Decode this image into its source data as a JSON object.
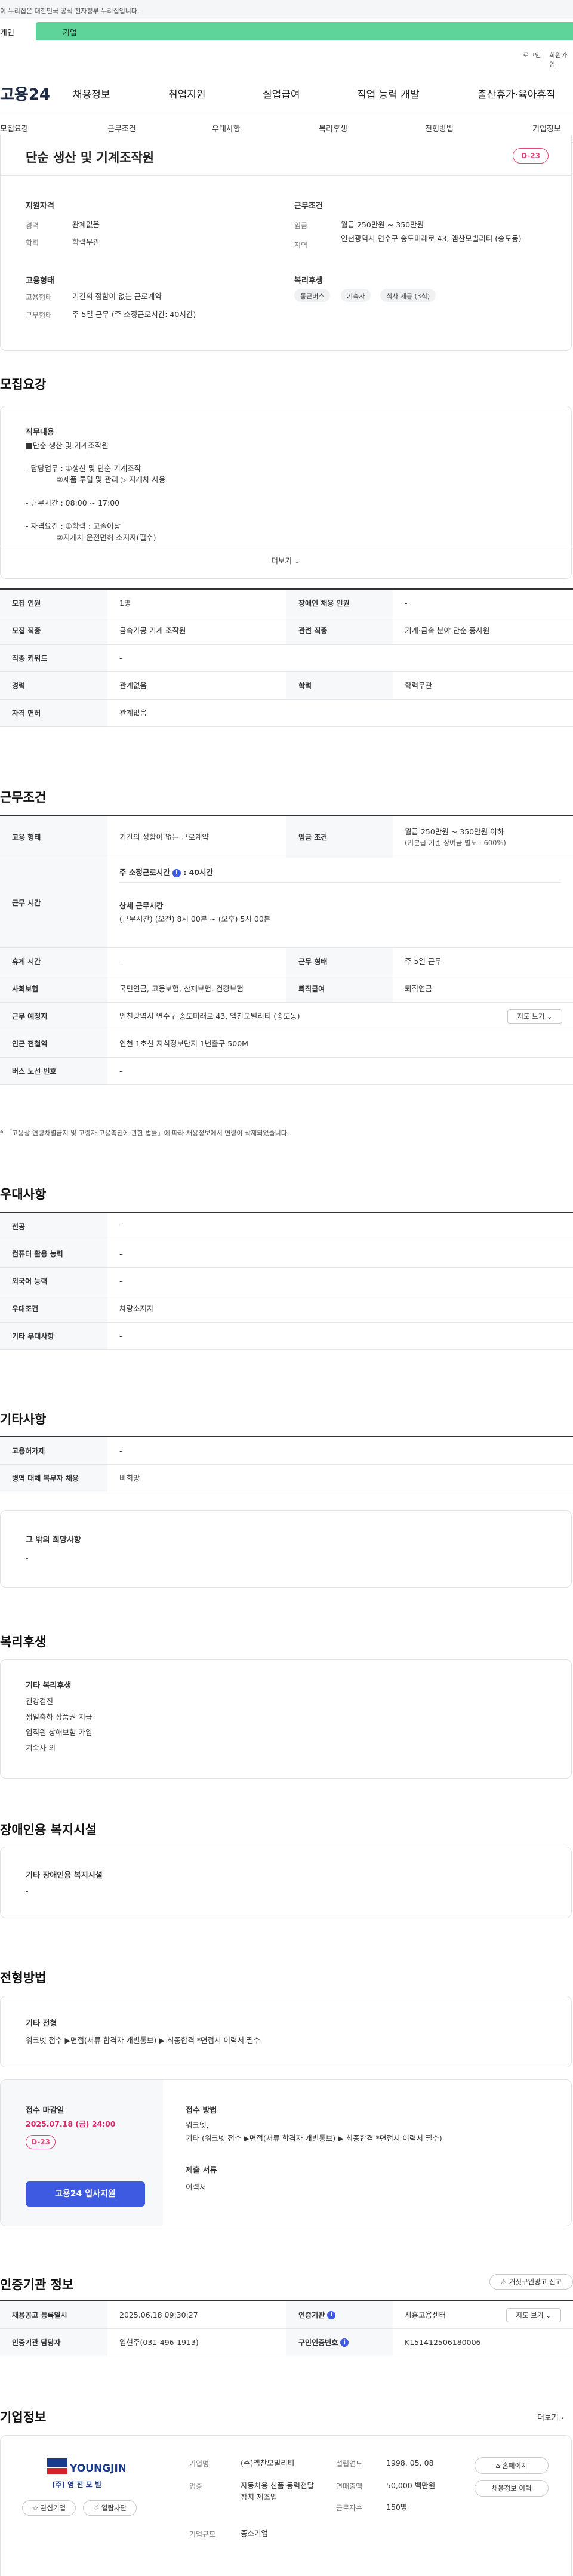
{
  "gov_banner": "이 누리집은 대한민국 공식 전자정부 누리집입니다.",
  "tabs": {
    "tab_personal": "개인",
    "tab_company": "기업"
  },
  "util": {
    "login": "로그인",
    "signup": "회원가입"
  },
  "gnb": {
    "logo": "고용24",
    "items": [
      "채용정보",
      "취업지원",
      "실업급여",
      "직업 능력 개발",
      "출산휴가·육아휴직"
    ]
  },
  "snb": [
    "모집요강",
    "근무조건",
    "우대사항",
    "복리후생",
    "전형방법",
    "기업정보"
  ],
  "summary": {
    "title": "단순 생산 및 기계조작원",
    "dday": "D-23",
    "qual_head": "지원자격",
    "exp_label": "경력",
    "exp_value": "관계없음",
    "edu_label": "학력",
    "edu_value": "학력무관",
    "emp_head": "고용형태",
    "emptype_label": "고용형태",
    "emptype_value": "기간의 정함이 없는 근로계약",
    "worktype_label": "근무형태",
    "worktype_value": "주 5일 근무 (주 소정근로시간: 40시간)",
    "cond_head": "근무조건",
    "wage_label": "임금",
    "wage_value": "월급 250만원 ~ 350만원",
    "area_label": "지역",
    "area_value": "인천광역시 연수구 송도미래로 43, 엠찬모빌리티 (송도동)",
    "welfare_head": "복리후생",
    "welfare_pills": [
      "통근버스",
      "기숙사",
      "식사 제공 (3식)"
    ]
  },
  "recruit": {
    "section_title": "모집요강",
    "duty_head": "직무내용",
    "duty_lines": [
      "■단순 생산 및 기계조작원",
      "- 담당업무 : ①생산 및 단순 기계조작",
      "             ②제품 투입 및 관리 ▷ 지게차 사용",
      "- 근무시간 : 08:00 ~ 17:00",
      "- 자격요건 : ①학력 : 고졸이상",
      "             ②지게차 운전면허 소지자(필수)"
    ],
    "more": "더보기 ⌄",
    "table": [
      [
        {
          "h": "모집 인원",
          "v": "1명"
        },
        {
          "h": "장애인 채용 인원",
          "v": "-"
        }
      ],
      [
        {
          "h": "모집 직종",
          "v": "금속가공 기계 조작원"
        },
        {
          "h": "관련 직종",
          "v": "기계·금속 분야 단순 종사원"
        }
      ],
      [
        {
          "h": "직종 키워드",
          "v": "-"
        }
      ],
      [
        {
          "h": "경력",
          "v": "관계없음"
        },
        {
          "h": "학력",
          "v": "학력무관"
        }
      ],
      [
        {
          "h": "자격 면허",
          "v": "관계없음"
        }
      ]
    ]
  },
  "work": {
    "section_title": "근무조건",
    "emptype_h": "고용 형태",
    "emptype_v": "기간의 정함이 없는 근로계약",
    "wage_h": "임금 조건",
    "wage_v1": "월급 250만원 ~ 350만원 이하",
    "wage_v2": "(기본급 기준 상여금 별도 : 600%)",
    "hours_h": "근무 시간",
    "hours_v1": "주 소정근로시간",
    "hours_info": "i",
    "hours_v1b": ": 40시간",
    "hours_v2": "상세 근무시간",
    "hours_v3": "(근무시간) (오전) 8시 00분 ~ (오후) 5시 00분",
    "break_h": "휴게 시간",
    "break_v": "-",
    "wkform_h": "근무 형태",
    "wkform_v": "주 5일 근무",
    "ins_h": "사회보험",
    "ins_v": "국민연금, 고용보험, 산재보험, 건강보험",
    "retire_h": "퇴직급여",
    "retire_v": "퇴직연금",
    "place_h": "근무 예정지",
    "place_v": "인천광역시 연수구 송도미래로 43, 엠찬모빌리티 (송도동)",
    "map_btn": "지도 보기 ⌄",
    "subway_h": "인근 전철역",
    "subway_v": "인천 1호선 지식정보단지 1번출구 500M",
    "bus_h": "버스 노선 번호",
    "bus_v": "-",
    "footnote": "* 「고용상 연령차별금지 및 고령자 고용촉진에 관한 법률」에 따라 채용정보에서 연령이 삭제되었습니다."
  },
  "pref": {
    "section_title": "우대사항",
    "rows": [
      {
        "h": "전공",
        "v": "-"
      },
      {
        "h": "컴퓨터 활용 능력",
        "v": "-"
      },
      {
        "h": "외국어 능력",
        "v": "-"
      },
      {
        "h": "우대조건",
        "v": "차량소지자"
      },
      {
        "h": "기타 우대사항",
        "v": "-"
      }
    ]
  },
  "etc": {
    "section_title": "기타사항",
    "rows": [
      {
        "h": "고용허가제",
        "v": "-"
      },
      {
        "h": "병역 대체 복무자 채용",
        "v": "비희망"
      }
    ],
    "other_head": "그 밖의 희망사항",
    "other_val": "-"
  },
  "welfare": {
    "section_title": "복리후생",
    "head": "기타 복리후생",
    "lines": [
      "건강검진",
      "생일축하 상품권 지급",
      "임직원 상해보험 가입",
      "기숙사 외"
    ]
  },
  "disabled": {
    "section_title": "장애인용 복지시설",
    "head": "기타 장애인용 복지시설",
    "val": "-"
  },
  "selection": {
    "section_title": "전형방법",
    "head": "기타 전형",
    "val": "워크넷 접수 ▶면접(서류 합격자 개별통보) ▶ 최종합격 *면접시 이력서 필수",
    "deadline_head": "접수 마감일",
    "deadline_val": "2025.07.18 (금) 24:00",
    "deadline_dday": "D-23",
    "apply_btn": "고용24 입사지원",
    "method_head": "접수 방법",
    "method_v1": "워크넷,",
    "method_v2": "기타 (워크넷 접수 ▶면접(서류 합격자 개별통보) ▶ 최종합격 *면접시 이력서 필수)",
    "docs_head": "제출 서류",
    "docs_val": "이력서"
  },
  "cert": {
    "section_title": "인증기관 정보",
    "report_btn": "거짓구인광고 신고",
    "reg_h": "채용공고 등록일시",
    "reg_v": "2025.06.18 09:30:27",
    "agency_h": "인증기관",
    "agency_v": "시흥고용센터",
    "map_btn": "지도 보기 ⌄",
    "manager_h": "인증기관 담당자",
    "manager_v": "임현주(031-496-1913)",
    "num_h": "구인인증번호",
    "num_v": "K151412506180006"
  },
  "company": {
    "section_title": "기업정보",
    "more": "더보기 ›",
    "logo_text": "YOUNGJIN",
    "logo_sub": "(주) 영 진 모 빌",
    "fav_btn": "☆ 관심기업",
    "block_btn": "♡ 열람차단",
    "name_h": "기업명",
    "name_v": "(주)엠찬모빌리티",
    "ind_h": "업종",
    "ind_v": "자동차용 신품 동력전달장치 제조업",
    "size_h": "기업규모",
    "size_v": "중소기업",
    "est_h": "설립연도",
    "est_v": "1998. 05. 08",
    "sales_h": "연매출액",
    "sales_v": "50,000 백만원",
    "emp_h": "근로자수",
    "emp_v": "150명",
    "home_btn": "홈페이지",
    "jobs_btn": "채용정보 이력"
  }
}
